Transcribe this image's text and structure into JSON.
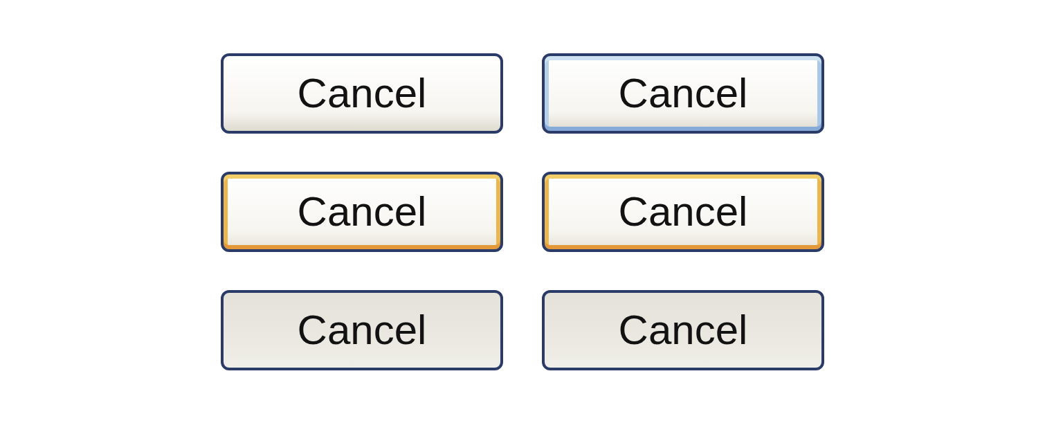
{
  "buttons": [
    {
      "label": "Cancel",
      "kind": "normal"
    },
    {
      "label": "Cancel",
      "kind": "default"
    },
    {
      "label": "Cancel",
      "kind": "hover"
    },
    {
      "label": "Cancel",
      "kind": "hover"
    },
    {
      "label": "Cancel",
      "kind": "pressed"
    },
    {
      "label": "Cancel",
      "kind": "pressed"
    }
  ]
}
